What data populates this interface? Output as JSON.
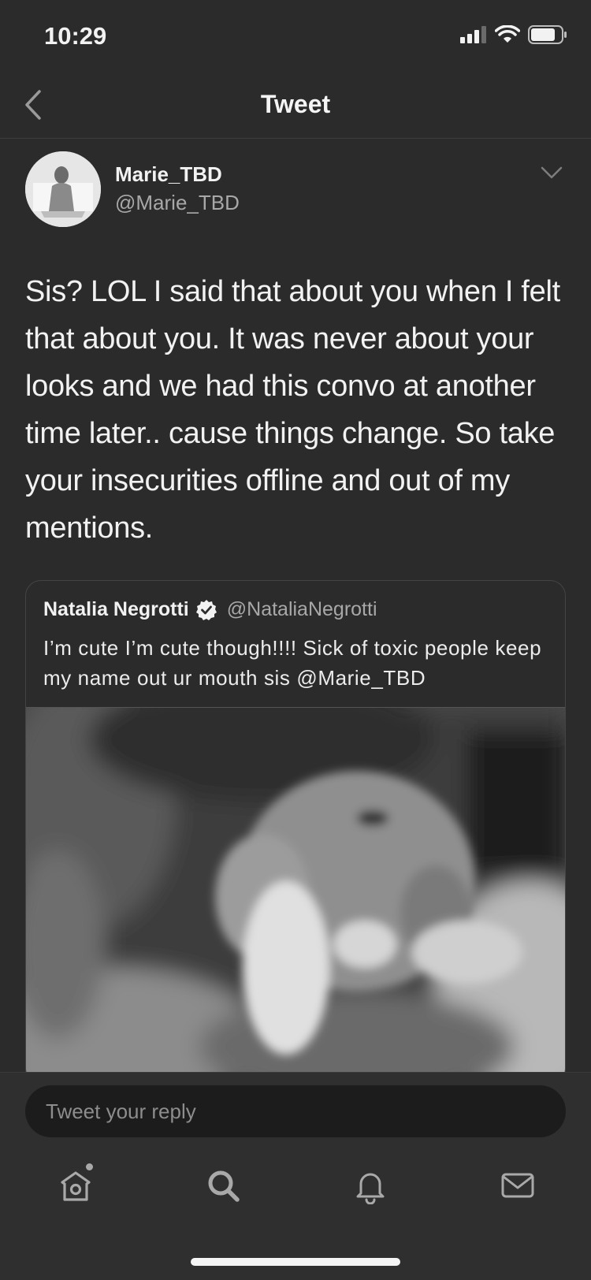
{
  "status_bar": {
    "time": "10:29"
  },
  "nav": {
    "title": "Tweet"
  },
  "tweet": {
    "author_name": "Marie_TBD",
    "author_handle": "@Marie_TBD",
    "text": "Sis? LOL I said that about you when I felt that about you. It was never about your looks and we had this convo at another time later.. cause things change. So take your insecurities offline and out of my mentions."
  },
  "quoted_tweet": {
    "author_name": "Natalia Negrotti",
    "author_handle": "@NataliaNegrotti",
    "verified": true,
    "text": "I’m cute I’m cute though!!!! Sick of toxic people keep my name out ur mouth sis @Marie_TBD",
    "media_icon": "grayscale-photo"
  },
  "reply": {
    "placeholder": "Tweet your reply"
  },
  "tabs": [
    {
      "icon": "home-icon",
      "has_dot": true
    },
    {
      "icon": "search-icon"
    },
    {
      "icon": "bell-icon"
    },
    {
      "icon": "mail-icon"
    }
  ]
}
